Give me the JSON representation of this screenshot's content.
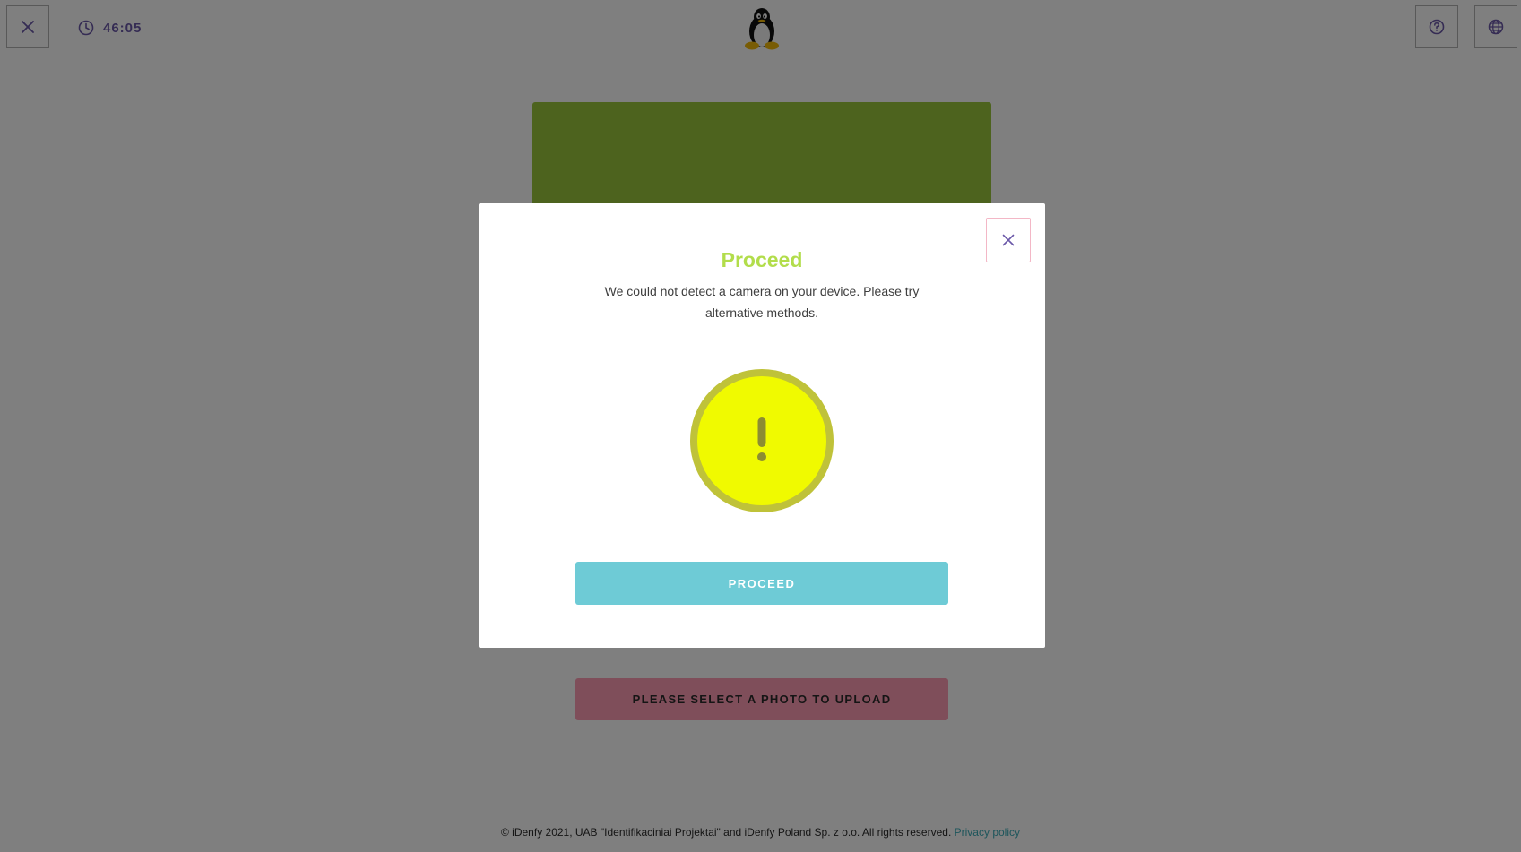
{
  "header": {
    "timer": "46:05",
    "icons": {
      "close": "close-icon",
      "clock": "clock-icon",
      "logo": "linux-penguin-logo",
      "help": "help-icon",
      "language": "globe-icon"
    }
  },
  "main": {
    "upload_button_label": "PLEASE SELECT A PHOTO TO UPLOAD"
  },
  "footer": {
    "copyright": "© iDenfy 2021, UAB \"Identifikaciniai Projektai\" and iDenfy Poland Sp. z o.o. All rights reserved.",
    "privacy_link": "Privacy policy"
  },
  "modal": {
    "title": "Proceed",
    "message": "We could not detect a camera on your device. Please try alternative methods.",
    "proceed_label": "PROCEED",
    "warning_icon": "exclamation-warning-icon"
  },
  "colors": {
    "accent_purple": "#6b58a8",
    "title_green": "#b2dd4b",
    "proceed_teal": "#6ecbd6",
    "upload_pink": "#ff9db4",
    "warning_yellow": "#f0fa00",
    "warning_ring": "#bfc239",
    "doc_green": "#9ac63d"
  }
}
